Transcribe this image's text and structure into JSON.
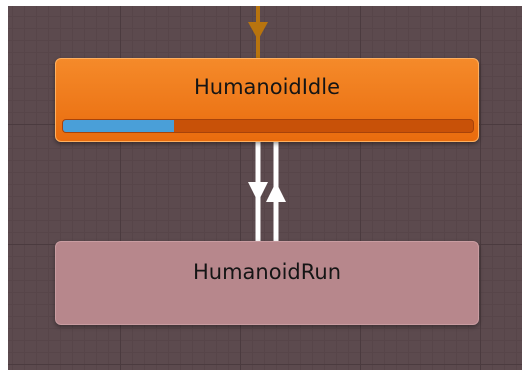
{
  "states": {
    "idle": {
      "name": "HumanoidIdle",
      "progress": 0.27,
      "color": "#f07a1a"
    },
    "run": {
      "name": "HumanoidRun",
      "color": "#b7878c"
    }
  },
  "colors": {
    "canvas_background": "#5c4a4e",
    "entry_transition": "#b8740e",
    "transition": "#ffffff",
    "progress_fill": "#4a9fd8"
  },
  "transitions": [
    {
      "from": "entry",
      "to": "HumanoidIdle",
      "icon": "arrow-down-icon"
    },
    {
      "from": "HumanoidIdle",
      "to": "HumanoidRun",
      "icon": "arrow-down-icon"
    },
    {
      "from": "HumanoidRun",
      "to": "HumanoidIdle",
      "icon": "arrow-up-icon"
    }
  ]
}
